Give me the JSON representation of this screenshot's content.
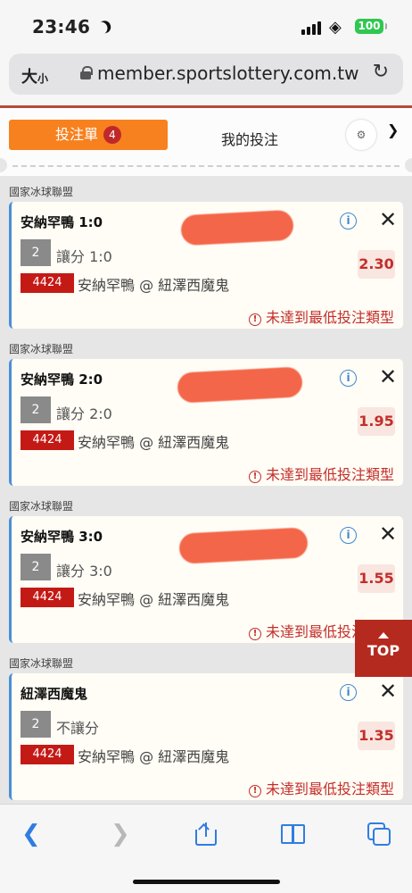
{
  "status_bar": {
    "time": "23:46",
    "battery": "100"
  },
  "browser": {
    "text_size_label": "大",
    "text_size_small": "小",
    "url": "member.sportslottery.com.tw"
  },
  "tabs": {
    "active_label": "投注單",
    "active_count": "4",
    "other_label": "我的投注"
  },
  "top_button": "TOP",
  "bets": [
    {
      "league": "國家冰球聯盟",
      "title": "安納罕鴨 1:0",
      "pill": "2",
      "bet_type": "讓分 1:0",
      "odds": "2.30",
      "code": "4424",
      "match": "安納罕鴨 @ 紐澤西魔鬼",
      "warning": "未達到最低投注類型"
    },
    {
      "league": "國家冰球聯盟",
      "title": "安納罕鴨 2:0",
      "pill": "2",
      "bet_type": "讓分 2:0",
      "odds": "1.95",
      "code": "4424",
      "match": "安納罕鴨 @ 紐澤西魔鬼",
      "warning": "未達到最低投注類型"
    },
    {
      "league": "國家冰球聯盟",
      "title": "安納罕鴨 3:0",
      "pill": "2",
      "bet_type": "讓分 3:0",
      "odds": "1.55",
      "code": "4424",
      "match": "安納罕鴨 @ 紐澤西魔鬼",
      "warning": "未達到最低投注類型"
    },
    {
      "league": "國家冰球聯盟",
      "title": "紐澤西魔鬼",
      "pill": "2",
      "bet_type": "不讓分",
      "odds": "1.35",
      "code": "4424",
      "match": "安納罕鴨 @ 紐澤西魔鬼",
      "warning": "未達到最低投注類型"
    }
  ],
  "colors": {
    "accent": "#f7811f",
    "badge": "#c0282a",
    "odds": "#c42e29",
    "card_border": "#4a8fd6",
    "ios_blue": "#2f7de1"
  },
  "icons": [
    "moon-icon",
    "signal-icon",
    "wifi-icon",
    "lock-icon",
    "reload-icon",
    "gear-icon",
    "chevron-down-icon",
    "info-icon",
    "close-icon",
    "warning-icon",
    "back-icon",
    "forward-icon",
    "share-icon",
    "bookmarks-icon",
    "tabs-icon"
  ]
}
